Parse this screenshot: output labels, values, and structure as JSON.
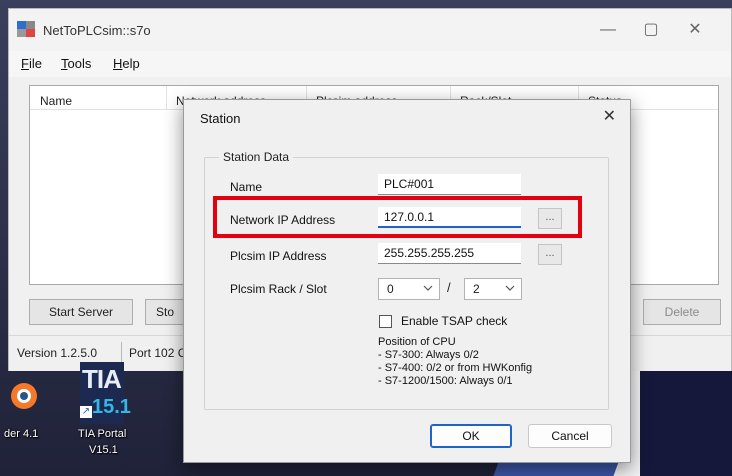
{
  "main_window": {
    "title": "NetToPLCsim::s7o",
    "controls": {
      "minimize": "—",
      "maximize": "▢",
      "close": "✕"
    }
  },
  "menu": {
    "file": {
      "hotkey": "F",
      "rest": "ile"
    },
    "tools": {
      "hotkey": "T",
      "rest": "ools"
    },
    "help": {
      "hotkey": "H",
      "rest": "elp"
    }
  },
  "server_list": {
    "columns": [
      "Name",
      "Network address",
      "Plcsim address",
      "Rack/Slot",
      "Status"
    ]
  },
  "buttons": {
    "start_server": "Start Server",
    "stop_partial": "Sto",
    "delete": "Delete"
  },
  "statusbar": {
    "version": "Version 1.2.5.0",
    "port_partial": "Port 102 C"
  },
  "desktop": {
    "icons": [
      {
        "label": "der 4.1",
        "icon": "blender-icon"
      },
      {
        "label_line1": "TIA Portal",
        "label_line2": "V15.1",
        "icon_text_top": "TIA",
        "icon_text_bottom": "15.1",
        "icon": "tia-portal-icon"
      }
    ]
  },
  "dialog": {
    "title": "Station",
    "close": "✕",
    "group_title": "Station Data",
    "fields": {
      "name_label": "Name",
      "name_value": "PLC#001",
      "network_ip_label": "Network IP Address",
      "network_ip_value": "127.0.0.1",
      "plcsim_ip_label": "Plcsim IP Address",
      "plcsim_ip_value": "255.255.255.255",
      "rack_slot_label": "Plcsim Rack / Slot",
      "rack_value": "0",
      "slot_value": "2",
      "slash": "/",
      "browse_label": "..."
    },
    "tsap": {
      "label": "Enable TSAP check",
      "checked": false
    },
    "cpu_info": [
      "Position of CPU",
      "- S7-300: Always 0/2",
      "- S7-400: 0/2 or from HWKonfig",
      "- S7-1200/1500: Always 0/1"
    ],
    "ok": "OK",
    "cancel": "Cancel"
  },
  "colors": {
    "highlight": "#e3000f",
    "focus_accent": "#1e64c8"
  }
}
